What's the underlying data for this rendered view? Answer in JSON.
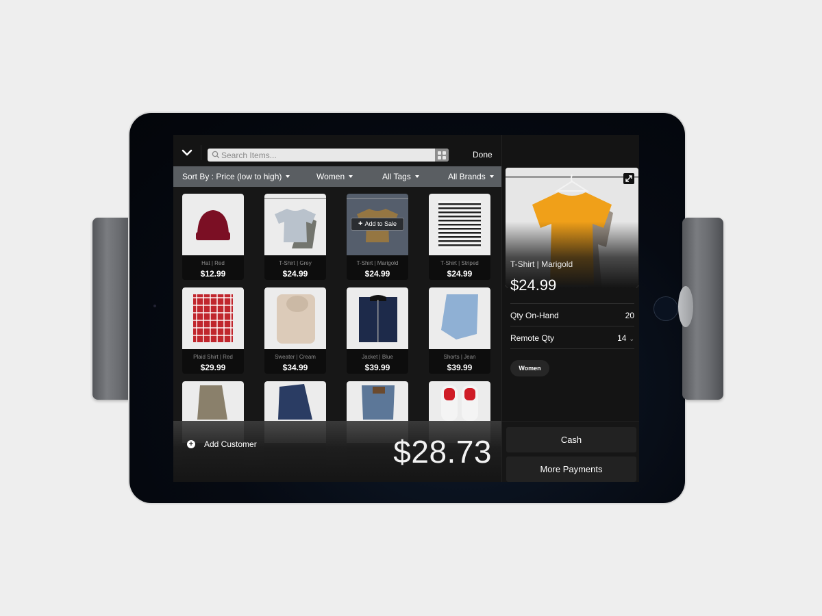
{
  "toolbar": {
    "search_placeholder": "Search Items...",
    "done_label": "Done"
  },
  "filters": {
    "sort": "Sort By : Price (low to high)",
    "category": "Women",
    "tags": "All Tags",
    "brands": "All Brands"
  },
  "products": [
    {
      "name": "Hat | Red",
      "price": "$12.99",
      "image": "red-beanie",
      "color": "#7b0f24"
    },
    {
      "name": "T-Shirt | Grey",
      "price": "$24.99",
      "image": "grey-tshirt-on-hanger",
      "color": "#b9c2cc"
    },
    {
      "name": "T-Shirt | Marigold",
      "price": "$24.99",
      "image": "marigold-tshirt-on-hanger",
      "color": "#e89a12",
      "selected": true,
      "overlay_label": "Add to Sale"
    },
    {
      "name": "T-Shirt | Striped",
      "price": "$24.99",
      "image": "striped-tshirt",
      "color": "#222222"
    },
    {
      "name": "Plaid Shirt | Red",
      "price": "$29.99",
      "image": "red-plaid-shirt",
      "color": "#c0262d"
    },
    {
      "name": "Sweater | Cream",
      "price": "$34.99",
      "image": "cream-sweater",
      "color": "#dccbb9"
    },
    {
      "name": "Jacket | Blue",
      "price": "$39.99",
      "image": "navy-jacket",
      "color": "#1d2a4a"
    },
    {
      "name": "Shorts | Jean",
      "price": "$39.99",
      "image": "jean-shorts",
      "color": "#8fb0d4"
    },
    {
      "name": "",
      "price": "",
      "image": "khaki-pants",
      "color": "#8a806b"
    },
    {
      "name": "",
      "price": "",
      "image": "dark-jeans",
      "color": "#2a3c63"
    },
    {
      "name": "",
      "price": "",
      "image": "light-jeans",
      "color": "#5c7798"
    },
    {
      "name": "",
      "price": "",
      "image": "white-red-sneakers",
      "color": "#cf1c26"
    }
  ],
  "sale": {
    "add_customer_label": "Add Customer",
    "total": "$28.73"
  },
  "detail": {
    "name": "T-Shirt | Marigold",
    "price": "$24.99",
    "image": "marigold-tshirt-on-hanger",
    "accent": "#f0a019",
    "rows": [
      {
        "label": "Qty On-Hand",
        "value": "20"
      },
      {
        "label": "Remote Qty",
        "value": "14",
        "expandable": true
      }
    ],
    "tags": [
      "Women"
    ]
  },
  "payments": {
    "cash_label": "Cash",
    "more_label": "More Payments"
  }
}
